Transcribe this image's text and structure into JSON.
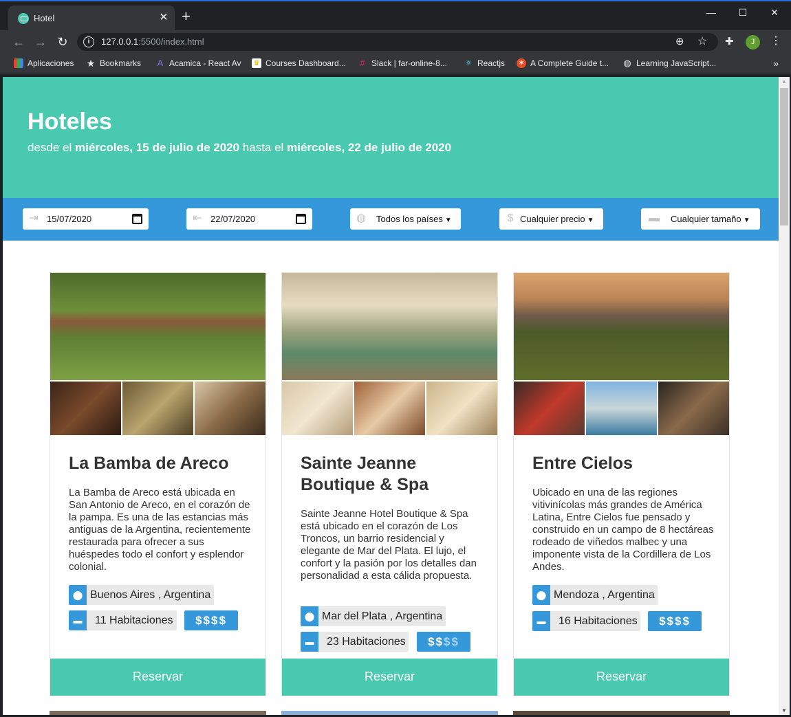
{
  "browser": {
    "tab_title": "Hotel",
    "tab_close": "✕",
    "new_tab": "+",
    "win_min": "—",
    "win_max": "☐",
    "win_close": "✕",
    "url_host": "127.0.0.1",
    "url_rest": ":5500/index.html",
    "avatar_letter": "J",
    "bookmarks": [
      {
        "label": "Aplicaciones",
        "icon": "apps-grid-icon"
      },
      {
        "label": "Bookmarks",
        "icon": "star-icon"
      },
      {
        "label": "Acamica - React Av",
        "icon": "acamica-icon"
      },
      {
        "label": "Courses Dashboard...",
        "icon": "crown-icon"
      },
      {
        "label": "Slack | far-online-8...",
        "icon": "slack-icon"
      },
      {
        "label": "Reactjs",
        "icon": "react-icon"
      },
      {
        "label": "A Complete Guide t...",
        "icon": "guide-icon"
      },
      {
        "label": "Learning JavaScript...",
        "icon": "globe-icon"
      }
    ],
    "bookmarks_more": "»"
  },
  "hero": {
    "title": "Hoteles",
    "sub_prefix": "desde el ",
    "date_from": "miércoles, 15 de julio de 2020",
    "sub_mid": " hasta el ",
    "date_to": "miércoles, 22 de julio de 2020"
  },
  "filters": {
    "check_in": "15/07/2020",
    "check_out": "22/07/2020",
    "country": "Todos los países",
    "price": "Cualquier precio",
    "size": "Cualquier tamaño"
  },
  "hotels": [
    {
      "name": "La Bamba de Areco",
      "description": "La Bamba de Areco está ubicada en San Antonio de Areco, en el corazón de la pampa. Es una de las estancias más antiguas de la Argentina, recientemente restaurada para ofrecer a sus huéspedes todo el confort y esplendor colonial.",
      "location": "Buenos Aires , Argentina",
      "rooms": "11 Habitaciones",
      "price_on": "$$$$",
      "price_off": "",
      "price_level": 4,
      "reserve": "Reservar"
    },
    {
      "name": "Sainte Jeanne Boutique & Spa",
      "description": "Sainte Jeanne Hotel Boutique & Spa está ubicado en el corazón de Los Troncos, un barrio residencial y elegante de Mar del Plata. El lujo, el confort y la pasión por los detalles dan personalidad a esta cálida propuesta.",
      "location": "Mar del Plata , Argentina",
      "rooms": "23 Habitaciones",
      "price_on": "$$",
      "price_off": "$$",
      "price_level": 2,
      "reserve": "Reservar"
    },
    {
      "name": "Entre Cielos",
      "description": "Ubicado en una de las regiones vitivinícolas más grandes de América Latina, Entre Cielos fue pensado y construido en un campo de 8 hectáreas rodeado de viñedos malbec y una imponente vista de la Cordillera de Los Andes.",
      "location": "Mendoza , Argentina",
      "rooms": "16 Habitaciones",
      "price_on": "$$$$",
      "price_off": "",
      "price_level": 4,
      "reserve": "Reservar"
    }
  ],
  "colors": {
    "hero": "#48c9b0",
    "filters_bar": "#3498db",
    "accent": "#3498db"
  }
}
